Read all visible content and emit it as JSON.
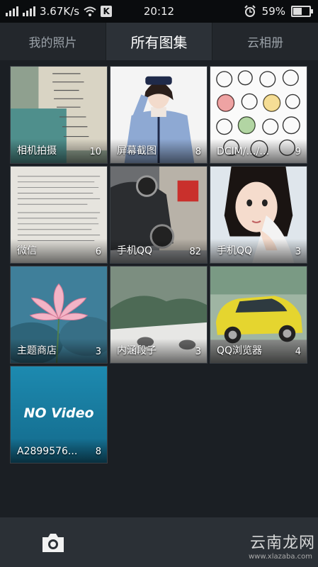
{
  "status": {
    "speed": "3.67K/s",
    "time": "20:12",
    "battery": "59%",
    "battery_level": 0.59,
    "icons": [
      "signal-icon",
      "wifi-icon",
      "k-app-icon",
      "alarm-icon",
      "battery-icon"
    ]
  },
  "tabs": [
    {
      "label": "我的照片",
      "active": false
    },
    {
      "label": "所有图集",
      "active": true
    },
    {
      "label": "云相册",
      "active": false
    }
  ],
  "albums": [
    {
      "name": "相机拍摄",
      "count": "10"
    },
    {
      "name": "屏幕截图",
      "count": "8"
    },
    {
      "name": "DCIM/…/…",
      "count": "9"
    },
    {
      "name": "微信",
      "count": "6"
    },
    {
      "name": "手机QQ",
      "count": "82"
    },
    {
      "name": "手机QQ",
      "count": "3"
    },
    {
      "name": "主题商店",
      "count": "3"
    },
    {
      "name": "内涵段子",
      "count": "3"
    },
    {
      "name": "QQ浏览器",
      "count": "4"
    },
    {
      "name": "A2899576...",
      "count": "8"
    }
  ],
  "video_tile_text": "NO Video",
  "bottom": {
    "watermark": "云南龙网",
    "watermark_sub": "www.xlazaba.com"
  }
}
